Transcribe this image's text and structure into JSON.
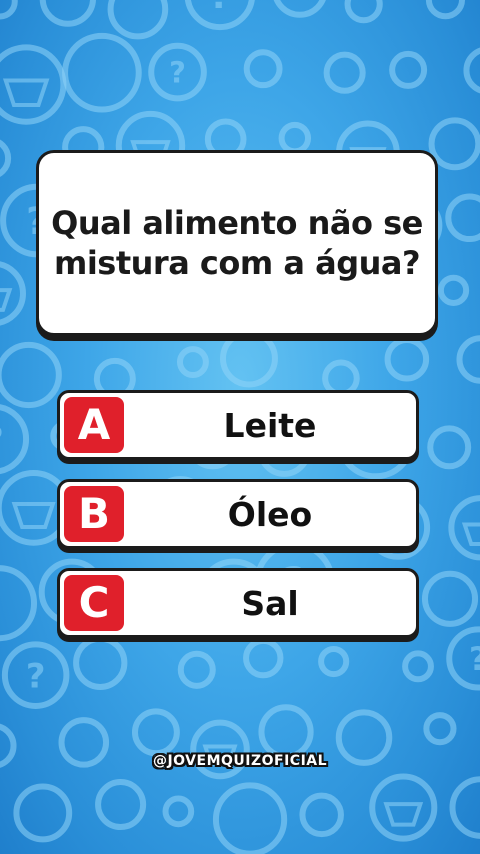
{
  "question": {
    "line1": "Qual alimento não se",
    "line2": "mistura com a água?"
  },
  "answers": [
    {
      "letter": "A",
      "label": "Leite"
    },
    {
      "letter": "B",
      "label": "Óleo"
    },
    {
      "letter": "C",
      "label": "Sal"
    }
  ],
  "footer": {
    "handle": "@JOVEMQUIZOFICIAL"
  },
  "colors": {
    "background": "#3ea6e8",
    "badge": "#e0202b",
    "card": "#ffffff",
    "outline": "#1b1b1b"
  },
  "icons": [
    "question-mark-circle-icon",
    "popcorn-circle-icon",
    "ring-icon"
  ]
}
